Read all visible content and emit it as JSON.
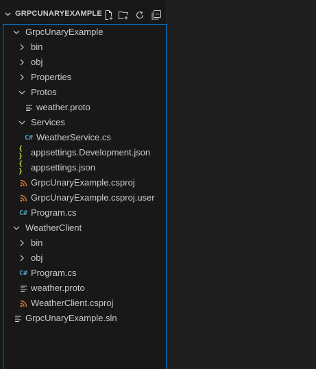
{
  "explorer": {
    "title": "GRPCUNARYEXAMPLE",
    "actions": [
      {
        "name": "new-file-button",
        "icon": "new-file-icon"
      },
      {
        "name": "new-folder-button",
        "icon": "new-folder-icon"
      },
      {
        "name": "refresh-button",
        "icon": "refresh-icon"
      },
      {
        "name": "collapse-all-button",
        "icon": "collapse-all-icon"
      }
    ]
  },
  "tree": [
    {
      "label": "GrpcUnaryExample",
      "kind": "folder",
      "depth": 0,
      "expanded": true
    },
    {
      "label": "bin",
      "kind": "folder",
      "depth": 1,
      "expanded": false
    },
    {
      "label": "obj",
      "kind": "folder",
      "depth": 1,
      "expanded": false
    },
    {
      "label": "Properties",
      "kind": "folder",
      "depth": 1,
      "expanded": false
    },
    {
      "label": "Protos",
      "kind": "folder",
      "depth": 1,
      "expanded": true
    },
    {
      "label": "weather.proto",
      "kind": "proto",
      "depth": 2
    },
    {
      "label": "Services",
      "kind": "folder",
      "depth": 1,
      "expanded": true
    },
    {
      "label": "WeatherService.cs",
      "kind": "csharp",
      "depth": 2
    },
    {
      "label": "appsettings.Development.json",
      "kind": "json",
      "depth": 1
    },
    {
      "label": "appsettings.json",
      "kind": "json",
      "depth": 1
    },
    {
      "label": "GrpcUnaryExample.csproj",
      "kind": "rss",
      "depth": 1
    },
    {
      "label": "GrpcUnaryExample.csproj.user",
      "kind": "rss",
      "depth": 1
    },
    {
      "label": "Program.cs",
      "kind": "csharp",
      "depth": 1
    },
    {
      "label": "WeatherClient",
      "kind": "folder",
      "depth": 0,
      "expanded": true
    },
    {
      "label": "bin",
      "kind": "folder",
      "depth": 1,
      "expanded": false
    },
    {
      "label": "obj",
      "kind": "folder",
      "depth": 1,
      "expanded": false
    },
    {
      "label": "Program.cs",
      "kind": "csharp",
      "depth": 1
    },
    {
      "label": "weather.proto",
      "kind": "proto",
      "depth": 1
    },
    {
      "label": "WeatherClient.csproj",
      "kind": "rss",
      "depth": 1
    },
    {
      "label": "GrpcUnaryExample.sln",
      "kind": "proto",
      "depth": 0
    }
  ],
  "colors": {
    "json": "#cbcb41",
    "csharp": "#519aba",
    "rss": "#e37933",
    "proto": "#cccccc",
    "chevron": "#cccccc",
    "focus_border": "#0078d4"
  }
}
